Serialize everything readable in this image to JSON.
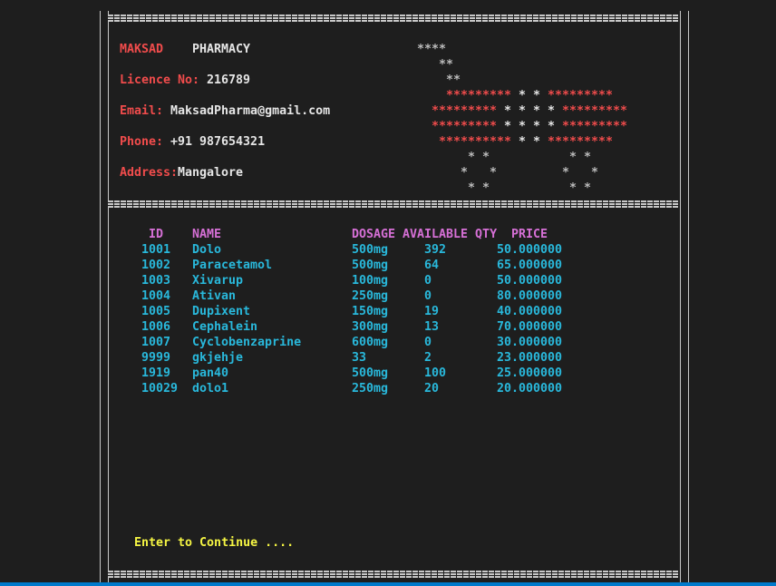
{
  "header": {
    "pharmacy_name": "MAKSAD",
    "pharmacy_word": "PHARMACY",
    "licence_label": "Licence No:",
    "licence_value": "216789",
    "email_label": "Email:",
    "email_value": "MaksadPharma@gmail.com",
    "phone_label": "Phone:",
    "phone_value": "+91 987654321",
    "address_label": "Address:",
    "address_value": "Mangalore"
  },
  "logo": {
    "l1": "****",
    "l2": "**",
    "l3": "**",
    "l4_left": "*********",
    "l4_mid": "* *",
    "l4_right": "*********",
    "l5_left": "*********",
    "l5_mid": "* * * *",
    "l5_right": "*********",
    "l6_left": "*********",
    "l6_mid": "* * * *",
    "l6_right": "*********",
    "l7_left": "**********",
    "l7_mid": "* *",
    "l7_right": "*********",
    "w1": "* *",
    "w2": "*   *",
    "w3": "* *"
  },
  "table": {
    "headers": {
      "id": "ID",
      "name": "NAME",
      "dosage": "DOSAGE",
      "qty": "AVAILABLE QTY",
      "price": "PRICE"
    },
    "rows": [
      {
        "id": "1001",
        "name": "Dolo",
        "dosage": "500mg",
        "qty": "392",
        "price": "50.000000"
      },
      {
        "id": "1002",
        "name": "Paracetamol",
        "dosage": "500mg",
        "qty": "64",
        "price": "65.000000"
      },
      {
        "id": "1003",
        "name": "Xivarup",
        "dosage": "100mg",
        "qty": "0",
        "price": "50.000000"
      },
      {
        "id": "1004",
        "name": "Ativan",
        "dosage": "250mg",
        "qty": "0",
        "price": "80.000000"
      },
      {
        "id": "1005",
        "name": "Dupixent",
        "dosage": "150mg",
        "qty": "19",
        "price": "40.000000"
      },
      {
        "id": "1006",
        "name": "Cephalein",
        "dosage": "300mg",
        "qty": "13",
        "price": "70.000000"
      },
      {
        "id": "1007",
        "name": "Cyclobenzaprine",
        "dosage": "600mg",
        "qty": "0",
        "price": "30.000000"
      },
      {
        "id": "9999",
        "name": "gkjehje",
        "dosage": "33",
        "qty": "2",
        "price": "23.000000"
      },
      {
        "id": "1919",
        "name": "pan40",
        "dosage": "500mg",
        "qty": "100",
        "price": "25.000000"
      },
      {
        "id": "10029",
        "name": "dolo1",
        "dosage": "250mg",
        "qty": "20",
        "price": "20.000000"
      }
    ]
  },
  "prompt": {
    "text": "Enter to Continue ...."
  },
  "colors": {
    "background": "#1e1e1e",
    "label": "#f14c4c",
    "header": "#d670d6",
    "data": "#29b8db",
    "prompt": "#f5f543",
    "statusbar": "#007acc"
  }
}
